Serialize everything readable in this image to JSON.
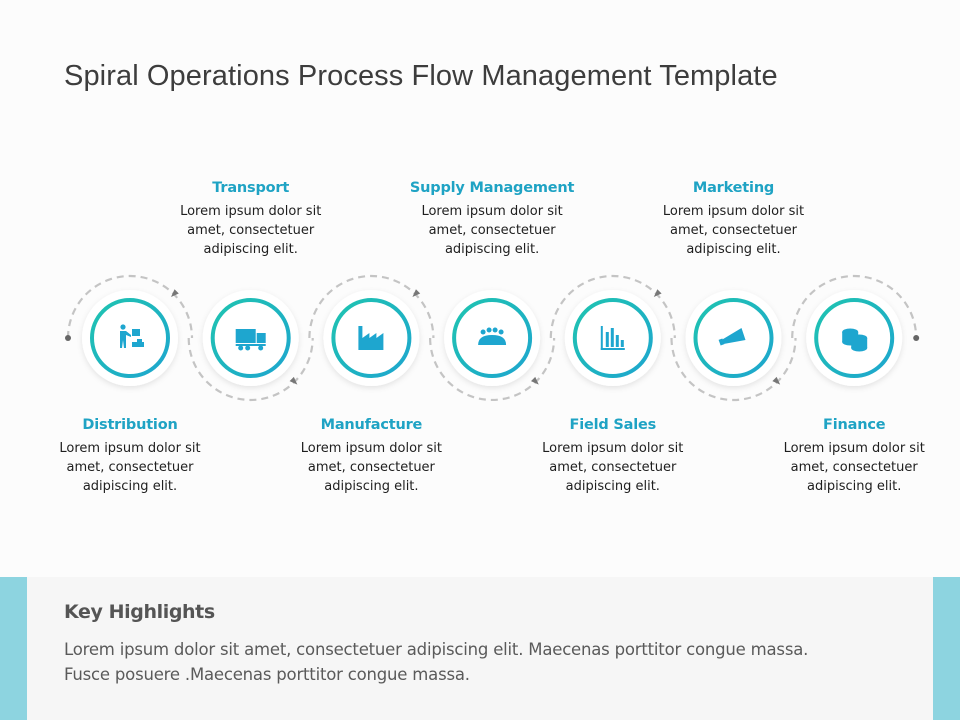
{
  "slide": {
    "title": "Spiral Operations Process Flow Management Template"
  },
  "colors": {
    "accent_teal": "#1fc4b0",
    "accent_blue": "#1ea6cf",
    "label_color": "#1fa3c4",
    "dash_color": "#c4c4c4",
    "side_bar": "#8dd4e0"
  },
  "steps": [
    {
      "title": "Distribution",
      "desc": [
        "Lorem ipsum dolor sit",
        "amet, consectetuer",
        "adipiscing elit."
      ],
      "icon": "worker-boxes-icon",
      "label_position": "below"
    },
    {
      "title": "Transport",
      "desc": [
        "Lorem ipsum dolor sit",
        "amet, consectetuer",
        "adipiscing elit."
      ],
      "icon": "truck-icon",
      "label_position": "above"
    },
    {
      "title": "Manufacture",
      "desc": [
        "Lorem ipsum dolor sit",
        "amet, consectetuer",
        "adipiscing elit."
      ],
      "icon": "factory-icon",
      "label_position": "below"
    },
    {
      "title": "Supply Management",
      "desc": [
        "Lorem ipsum dolor sit",
        "amet, consectetuer",
        "adipiscing elit."
      ],
      "icon": "team-meeting-icon",
      "label_position": "above"
    },
    {
      "title": "Field Sales",
      "desc": [
        "Lorem ipsum dolor sit",
        "amet, consectetuer",
        "adipiscing elit."
      ],
      "icon": "bar-chart-icon",
      "label_position": "below"
    },
    {
      "title": "Marketing",
      "desc": [
        "Lorem ipsum dolor sit",
        "amet, consectetuer",
        "adipiscing elit."
      ],
      "icon": "megaphone-icon",
      "label_position": "above"
    },
    {
      "title": "Finance",
      "desc": [
        "Lorem ipsum dolor sit",
        "amet, consectetuer",
        "adipiscing elit."
      ],
      "icon": "coins-icon",
      "label_position": "below"
    }
  ],
  "highlights": {
    "title": "Key Highlights",
    "lines": [
      "Lorem ipsum dolor sit amet, consectetuer  adipiscing elit. Maecenas porttitor congue massa.",
      "Fusce posuere .Maecenas  porttitor congue massa."
    ]
  }
}
